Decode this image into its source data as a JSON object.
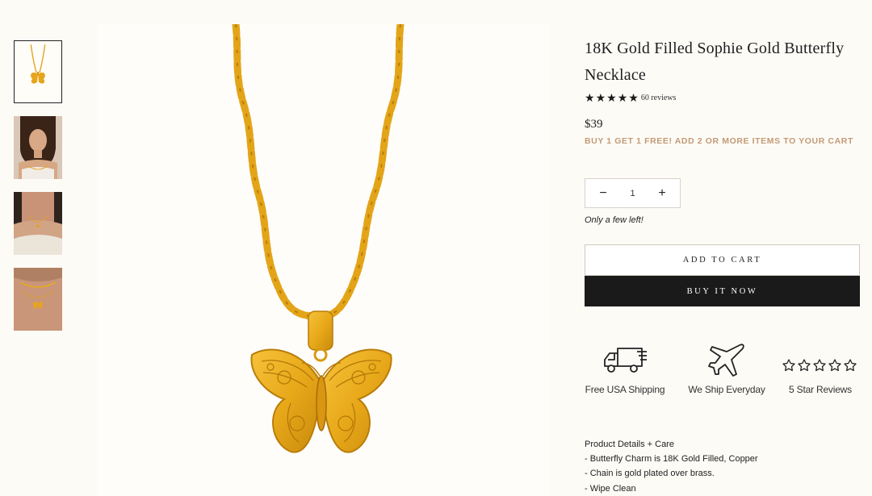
{
  "product": {
    "title_line1": "18K Gold Filled Sophie Gold Butterfly",
    "title_line2": "Necklace",
    "reviews": "60 reviews",
    "price": "$39",
    "promo": "BUY 1 GET 1 FREE! ADD 2 OR MORE ITEMS TO YOUR CART"
  },
  "quantity": {
    "value": "1",
    "minus": "−",
    "plus": "+"
  },
  "stock_note": "Only a few left!",
  "buttons": {
    "add_to_cart": "ADD TO CART",
    "buy_now": "BUY IT NOW"
  },
  "features": [
    {
      "icon": "truck-icon",
      "label": "Free USA Shipping"
    },
    {
      "icon": "airplane-icon",
      "label": "We Ship Everyday"
    },
    {
      "icon": "five-stars-icon",
      "label": "5 Star Reviews"
    }
  ],
  "details": {
    "heading": "Product Details + Care",
    "lines": [
      "- Butterfly Charm is 18K Gold Filled, Copper",
      "- Chain is gold plated over brass.",
      "- Wipe Clean"
    ]
  },
  "colors": {
    "gold": "#e8a91a",
    "gold_dark": "#b97d0a",
    "promo": "#c39a76",
    "buy_now_bg": "#1a1a1a"
  }
}
